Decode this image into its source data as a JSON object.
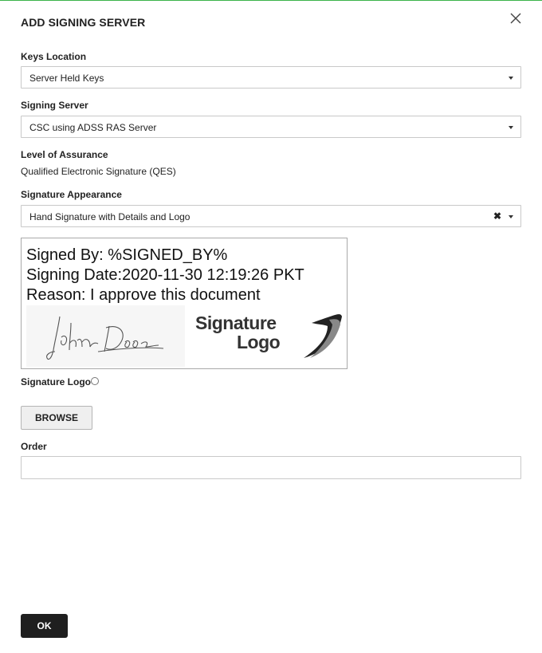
{
  "dialog": {
    "title": "ADD SIGNING SERVER",
    "close_icon": "close-icon"
  },
  "keys_location": {
    "label": "Keys Location",
    "selected": "Server Held Keys"
  },
  "signing_server": {
    "label": "Signing Server",
    "selected": "CSC using ADSS RAS Server"
  },
  "level_of_assurance": {
    "label": "Level of Assurance",
    "value": "Qualified Electronic Signature (QES)"
  },
  "signature_appearance": {
    "label": "Signature Appearance",
    "selected": "Hand Signature with Details and Logo",
    "clear_glyph": "✖"
  },
  "preview": {
    "signed_by": "Signed By: %SIGNED_BY%",
    "signing_date": "Signing Date:2020-11-30 12:19:26 PKT",
    "reason": "Reason: I approve this document",
    "logo_line1": "Signature",
    "logo_line2": "Logo"
  },
  "signature_logo": {
    "label": "Signature Logo",
    "browse_label": "BROWSE"
  },
  "order": {
    "label": "Order",
    "value": ""
  },
  "footer": {
    "ok_label": "OK"
  },
  "colors": {
    "accent_line": "#3cb34a",
    "ok_button_bg": "#1f1f1f"
  }
}
